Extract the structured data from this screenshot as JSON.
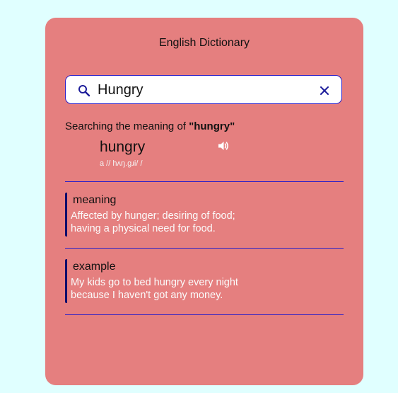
{
  "app": {
    "title": "English Dictionary"
  },
  "search": {
    "value": "Hungry",
    "placeholder": ""
  },
  "status": {
    "prefix": "Searching the meaning of ",
    "query": "\"hungry\""
  },
  "result": {
    "word": "hungry",
    "phonetic": "a // hʌŋ.ɡɹi/ /"
  },
  "meaning": {
    "label": "meaning",
    "text": "Affected by hunger; desiring of food; having a physical need for food."
  },
  "example": {
    "label": "example",
    "text": "My kids go to bed hungry every night because I haven't got any money."
  },
  "icons": {
    "search": "search-icon",
    "clear": "close-icon",
    "audio": "speaker-icon"
  },
  "colors": {
    "page_bg": "#e0ffff",
    "card_bg": "#e57f7f",
    "accent": "#2a1fc7",
    "text_light": "#fbfbfb"
  }
}
